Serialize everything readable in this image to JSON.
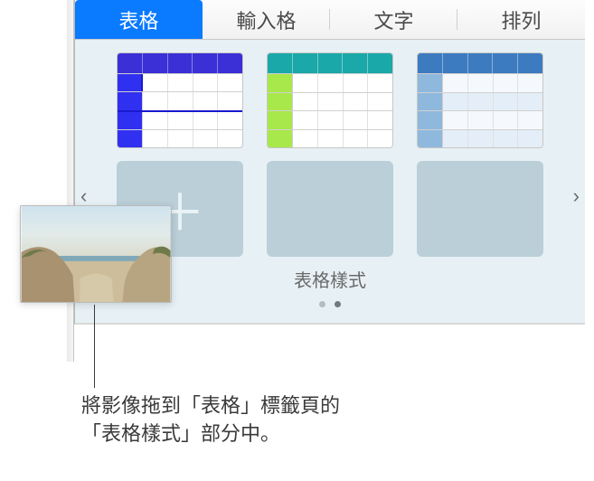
{
  "tabs": {
    "t0": "表格",
    "t1": "輸入格",
    "t2": "文字",
    "t3": "排列"
  },
  "section": {
    "title": "表格樣式"
  },
  "icons": {
    "prev": "‹",
    "next": "›",
    "add": "＋"
  },
  "callout": {
    "line1": "將影像拖到「表格」標籤頁的",
    "line2": "「表格樣式」部分中。"
  }
}
